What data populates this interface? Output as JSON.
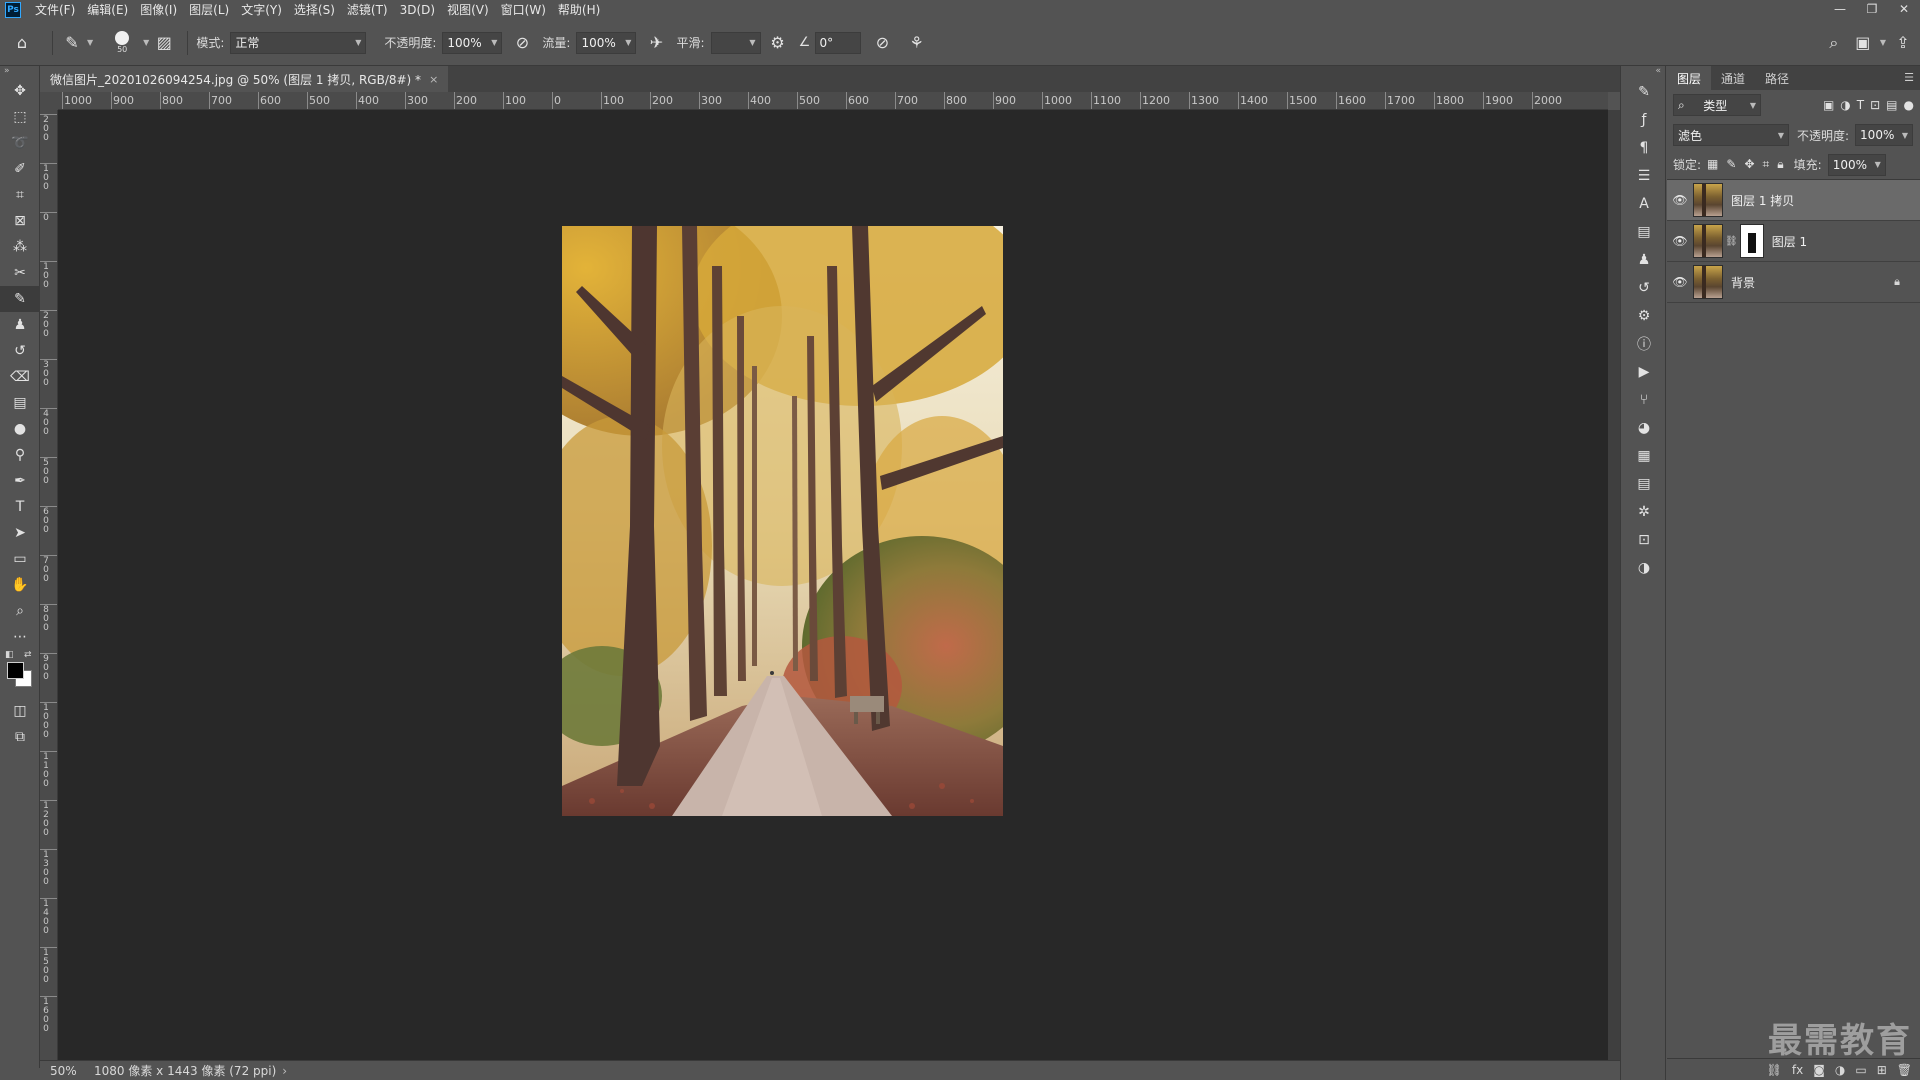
{
  "app": {
    "logo": "Ps"
  },
  "menu": [
    "文件(F)",
    "编辑(E)",
    "图像(I)",
    "图层(L)",
    "文字(Y)",
    "选择(S)",
    "滤镜(T)",
    "3D(D)",
    "视图(V)",
    "窗口(W)",
    "帮助(H)"
  ],
  "window_controls": {
    "minimize": "—",
    "restore": "❐",
    "close": "✕"
  },
  "options": {
    "brush_size": "50",
    "mode_label": "模式:",
    "mode_value": "正常",
    "opacity_label": "不透明度:",
    "opacity_value": "100%",
    "flow_label": "流量:",
    "flow_value": "100%",
    "smooth_label": "平滑:",
    "smooth_value": "",
    "angle_value": "0°"
  },
  "document": {
    "tab_title": "微信图片_20201026094254.jpg @ 50% (图层 1 拷贝, RGB/8#) *",
    "close_glyph": "×"
  },
  "ruler_top_labels": [
    "1000",
    "900",
    "800",
    "700",
    "600",
    "500",
    "400",
    "300",
    "200",
    "100",
    "0",
    "100",
    "200",
    "300",
    "400",
    "500",
    "600",
    "700",
    "800",
    "900",
    "1000",
    "1100",
    "1200",
    "1300",
    "1400",
    "1500",
    "1600",
    "1700",
    "1800",
    "1900",
    "2000"
  ],
  "ruler_left_labels": [
    "2 0 0",
    "1 0 0",
    "0",
    "1 0 0",
    "2 0 0",
    "3 0 0",
    "4 0 0",
    "5 0 0",
    "6 0 0",
    "7 0 0",
    "8 0 0",
    "9 0 0",
    "1 0 0 0",
    "1 1 0 0",
    "1 2 0 0",
    "1 3 0 0",
    "1 4 0 0",
    "1 5 0 0",
    "1 6 0 0"
  ],
  "status": {
    "zoom": "50%",
    "info": "1080 像素 x 1443 像素 (72 ppi)",
    "arrow": "›"
  },
  "layers_panel": {
    "tabs": [
      "图层",
      "通道",
      "路径"
    ],
    "filter_kind": "类型",
    "blend_mode": "滤色",
    "opacity_label": "不透明度:",
    "opacity_value": "100%",
    "lock_label": "锁定:",
    "fill_label": "填充:",
    "fill_value": "100%",
    "layers": [
      {
        "name": "图层 1 拷贝",
        "selected": true,
        "has_mask": false,
        "locked": false
      },
      {
        "name": "图层 1",
        "selected": false,
        "has_mask": true,
        "locked": false
      },
      {
        "name": "背景",
        "selected": false,
        "has_mask": false,
        "locked": true
      }
    ]
  },
  "watermark": "最需教育",
  "colors": {
    "foreground": "#000000",
    "background": "#ffffff",
    "canvas_bg": "#282828",
    "ui": "#535353"
  }
}
